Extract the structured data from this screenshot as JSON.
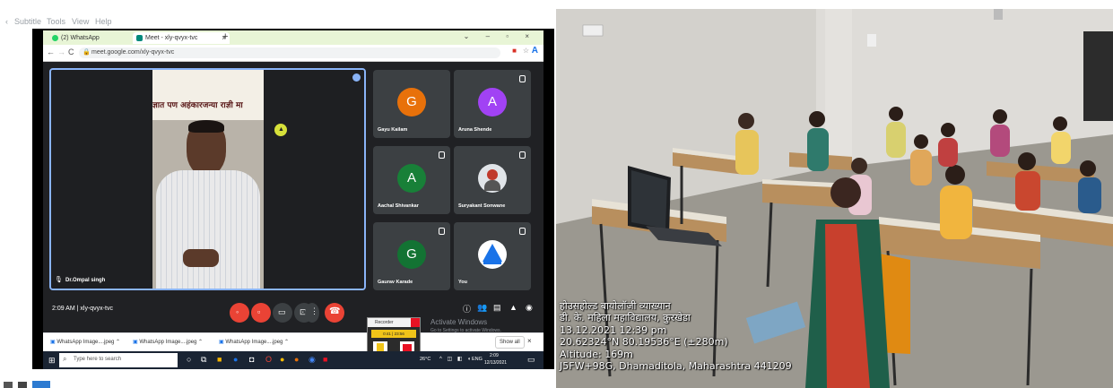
{
  "menubar": {
    "items": [
      "Subtitle",
      "Tools",
      "View",
      "Help"
    ]
  },
  "browser": {
    "tabs": [
      {
        "label": "(2) WhatsApp",
        "icon": "whatsapp-icon",
        "active": false
      },
      {
        "label": "Meet - xly-qvyx-tvc",
        "icon": "meet-icon",
        "active": true
      }
    ],
    "new_tab": "+",
    "url": "meet.google.com/xly-qvyx-tvc"
  },
  "meet": {
    "presenter_name": "Dr.Ompal singh",
    "banner_text": "ज्ञात पण अहंकारजन्या राज्ञी मा",
    "participants": [
      {
        "name": "Gayu Kailam",
        "initial": "G",
        "color": "#e8710a"
      },
      {
        "name": "Aruna Shende",
        "initial": "A",
        "color": "#a142f4"
      },
      {
        "name": "Aachal Shivankar",
        "initial": "A",
        "color": "#188038"
      },
      {
        "name": "Suryakant Sonwane",
        "initial": "",
        "color": "#ffffff"
      },
      {
        "name": "Gaurav Karade",
        "initial": "G",
        "color": "#137333"
      },
      {
        "name": "You",
        "initial": "",
        "color": "#ffffff"
      }
    ],
    "meeting_info": "2:09 AM | xly-qvyx-tvc",
    "activate_windows": "Activate Windows",
    "activate_sub": "Go to Settings to activate Windows."
  },
  "downloads": {
    "items": [
      "WhatsApp Image....jpeg",
      "WhatsApp Image....jpeg",
      "WhatsApp Image....jpeg"
    ],
    "show_all": "Show all"
  },
  "recorder": {
    "title": "Recorder",
    "timer": "0:41 | 23:56",
    "pause_label": "Pause",
    "stop_label": "Stop"
  },
  "taskbar": {
    "search_placeholder": "Type here to search",
    "weather": "26°C",
    "lang": "ENG",
    "time": "2:09",
    "date": "12/13/2021"
  },
  "photo_overlay": {
    "lines": [
      "होउसहोल्ड बायोलॉजी व्याख्यान",
      "डी. के. महिला महाविद्यालय, कुरखेडा",
      "13.12.2021 12:39 pm",
      "20.62324°N 80.19536°E (±280m)",
      "Altitude: 169m",
      "J5FW+98G, Dhamaditola, Maharashtra 441209"
    ]
  }
}
